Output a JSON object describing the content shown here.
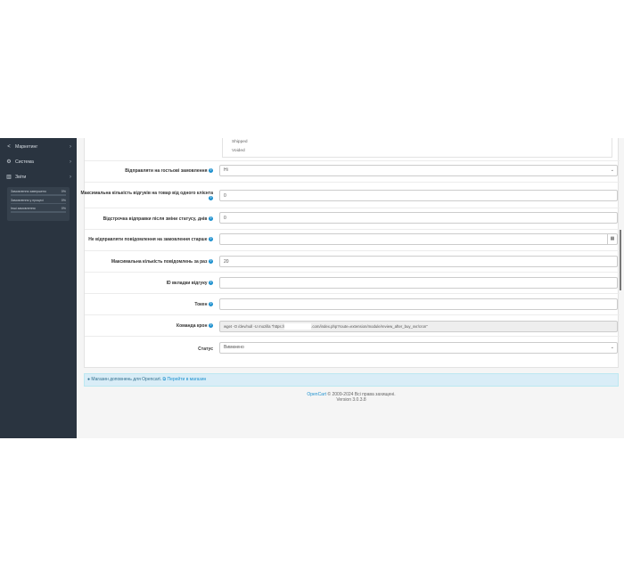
{
  "sidebar": {
    "items": [
      {
        "label": "Маркетинг",
        "icon": "share-icon"
      },
      {
        "label": "Система",
        "icon": "gear-icon"
      },
      {
        "label": "Звіти",
        "icon": "bar-chart-icon"
      }
    ],
    "stats": [
      {
        "label": "Замовлення завершено",
        "value": "0%",
        "fraction": 0.0
      },
      {
        "label": "Замовлення у процесі",
        "value": "0%",
        "fraction": 0.0
      },
      {
        "label": "Інші замовлення",
        "value": "0%",
        "fraction": 0.0
      }
    ]
  },
  "form": {
    "status_list": [
      "Shipped",
      "Voided"
    ],
    "guest_label": "Відправляти на гостьові замовлення",
    "guest_value": "Ні",
    "max_reviews_label": "Максимальна кількість відгуків на товар від одного клієнта",
    "max_reviews_value": "0",
    "delay_label": "Відстрочка відправки після зміни статусу, днів",
    "delay_value": "0",
    "no_send_before_label": "Не відправляти повідомлення на замовлення старше",
    "no_send_before_value": "",
    "max_messages_label": "Максимальна кількість повідомлень за раз",
    "max_messages_value": "20",
    "tab_id_label": "ID вкладки відгуку",
    "tab_id_value": "",
    "token_label": "Токен",
    "token_value": "",
    "cron_label": "Команда крон",
    "cron_value_start": "wget -O /dev/null -U mozilla \"https://",
    "cron_value_end": ".com/index.php?route=extension/module/review_after_buy_svr/cron\"",
    "status_label": "Статус",
    "status_value": "Вимкнено"
  },
  "alert": {
    "text": "Магазин доповнень для Opencart.",
    "link": "Перейти в магазин"
  },
  "footer": {
    "brand": "OpenCart",
    "rights": "© 2009-2024 Всі права захищені.",
    "version": "Version 3.0.3.8"
  },
  "colors": {
    "sidebar_bg": "#2a3440",
    "accent": "#1e91cf",
    "alert_bg": "#d9edf7"
  }
}
